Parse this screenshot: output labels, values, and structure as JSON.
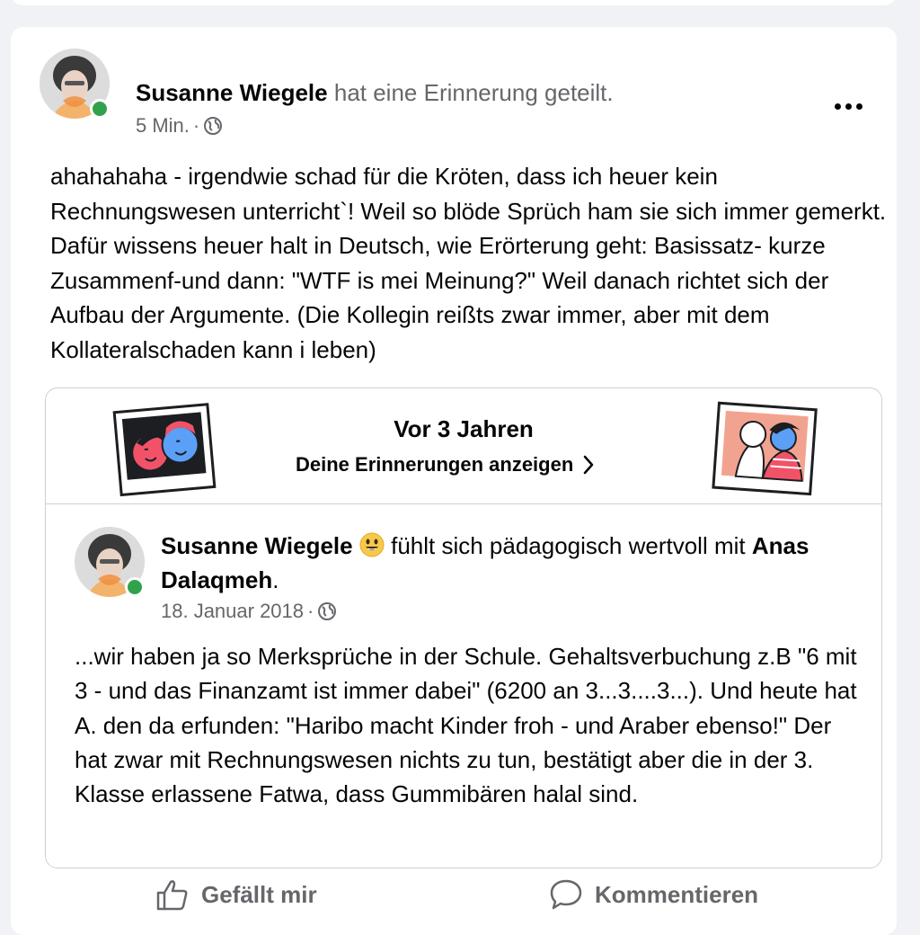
{
  "post": {
    "author": "Susanne Wiegele",
    "action": "hat eine Erinnerung geteilt.",
    "time": "5 Min.",
    "separator": "·",
    "audience_icon": "globe-icon",
    "text": "ahahahaha - irgendwie schad für die Kröten, dass ich heuer kein Rechnungswesen unterricht`! Weil so blöde Sprüch ham sie sich immer gemerkt. Dafür wissens heuer halt in Deutsch, wie Erörterung geht: Basissatz- kurze Zusammenf-und dann: \"WTF is mei Meinung?\" Weil danach richtet sich der Aufbau der Argumente. (Die Kollegin reißts zwar immer, aber mit dem Kollateralschaden kann i leben)"
  },
  "memory": {
    "title": "Vor 3 Jahren",
    "link_label": "Deine Erinnerungen anzeigen"
  },
  "shared_post": {
    "author": "Susanne Wiegele",
    "feeling": "fühlt sich pädagogisch wertvoll mit",
    "tagged": "Anas Dalaqmeh",
    "tagged_suffix": ".",
    "date": "18. Januar 2018",
    "separator": "·",
    "text": "...wir haben ja so Merksprüche in der Schule. Gehaltsverbuchung z.B \"6 mit 3 - und das Finanzamt ist immer dabei\" (6200 an 3...3....3...). Und heute hat A. den da erfunden: \"Haribo macht Kinder froh - und Araber ebenso!\" Der hat zwar mit Rechnungswesen nichts zu tun, bestätigt aber die in der 3. Klasse erlassene Fatwa, dass Gummibären halal sind."
  },
  "actions": {
    "like_label": "Gefällt mir",
    "comment_label": "Kommentieren"
  },
  "colors": {
    "background": "#f0f2f5",
    "card": "#ffffff",
    "text": "#050505",
    "muted": "#65676b",
    "online": "#31a24c",
    "border": "#ced0d4"
  }
}
